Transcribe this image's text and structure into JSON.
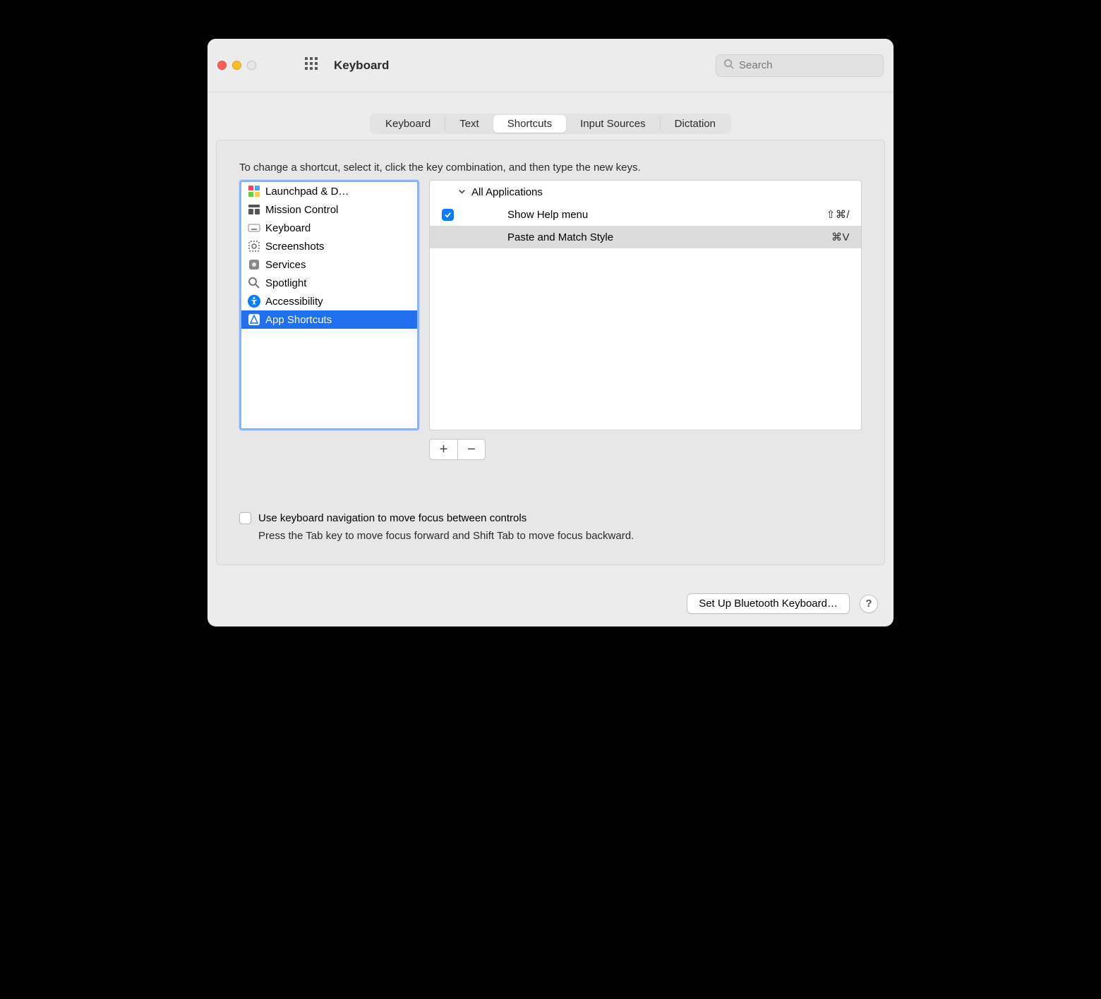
{
  "window": {
    "title": "Keyboard"
  },
  "search": {
    "placeholder": "Search"
  },
  "tabs": {
    "items": [
      "Keyboard",
      "Text",
      "Shortcuts",
      "Input Sources",
      "Dictation"
    ],
    "active": 2
  },
  "instruction": "To change a shortcut, select it, click the key combination, and then type the new keys.",
  "categories": [
    {
      "label": "Launchpad & D…",
      "icon": "launchpad-icon"
    },
    {
      "label": "Mission Control",
      "icon": "mission-control-icon"
    },
    {
      "label": "Keyboard",
      "icon": "keyboard-icon"
    },
    {
      "label": "Screenshots",
      "icon": "screenshots-icon"
    },
    {
      "label": "Services",
      "icon": "services-icon"
    },
    {
      "label": "Spotlight",
      "icon": "spotlight-icon"
    },
    {
      "label": "Accessibility",
      "icon": "accessibility-icon"
    },
    {
      "label": "App Shortcuts",
      "icon": "app-shortcuts-icon"
    }
  ],
  "categories_selected": 7,
  "shortcuts": {
    "group_label": "All Applications",
    "items": [
      {
        "checked": true,
        "label": "Show Help menu",
        "keys": "⇧⌘/"
      },
      {
        "checked": false,
        "label": "Paste and Match Style",
        "keys": "⌘V"
      }
    ],
    "selected": 1
  },
  "nav_checkbox": {
    "label": "Use keyboard navigation to move focus between controls",
    "hint": "Press the Tab key to move focus forward and Shift Tab to move focus backward.",
    "checked": false
  },
  "footer": {
    "bluetooth_label": "Set Up Bluetooth Keyboard…"
  }
}
